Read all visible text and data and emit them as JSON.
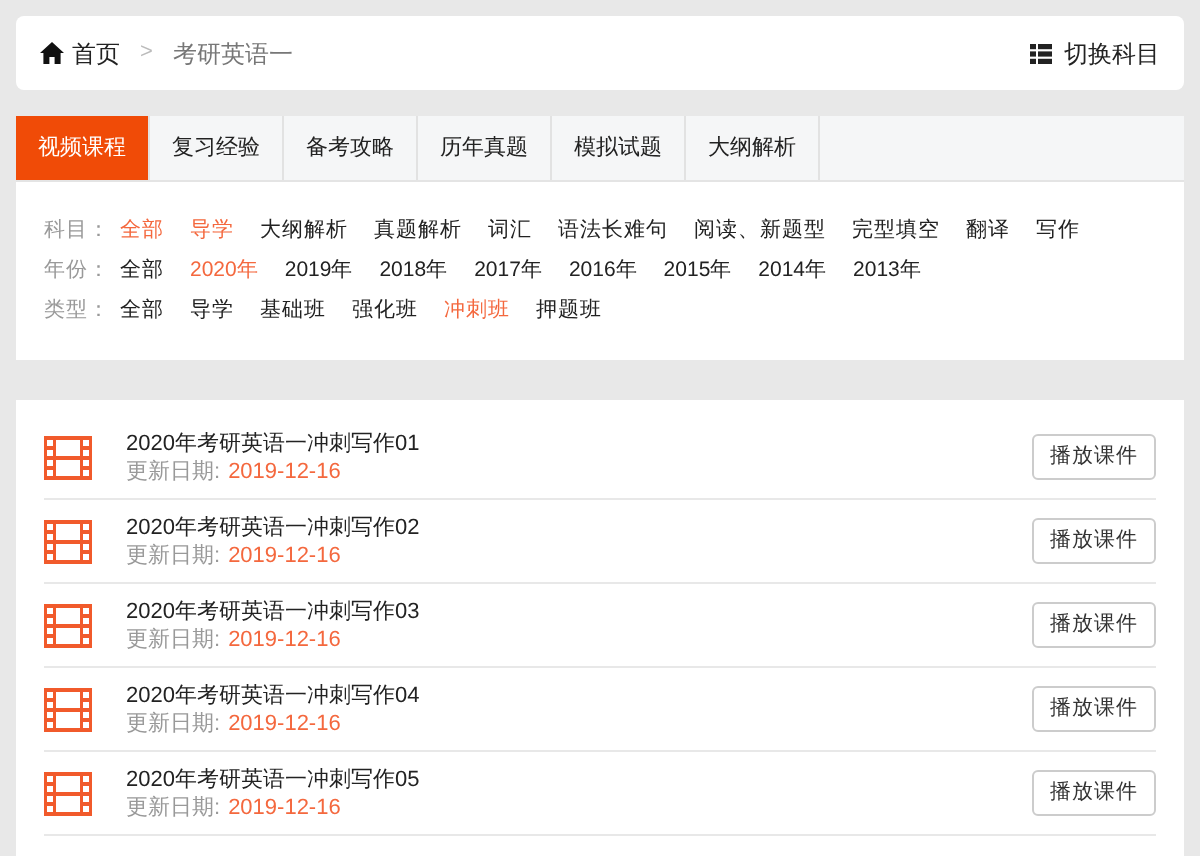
{
  "breadcrumb": {
    "home": "首页",
    "separator": ">",
    "current": "考研英语一"
  },
  "switch_button": "切换科目",
  "tabs": [
    {
      "label": "视频课程",
      "selected": true
    },
    {
      "label": "复习经验",
      "selected": false
    },
    {
      "label": "备考攻略",
      "selected": false
    },
    {
      "label": "历年真题",
      "selected": false
    },
    {
      "label": "模拟试题",
      "selected": false
    },
    {
      "label": "大纲解析",
      "selected": false
    }
  ],
  "filters": [
    {
      "label": "科目：",
      "options": [
        {
          "label": "全部",
          "selected": true
        },
        {
          "label": "导学",
          "selected": true
        },
        {
          "label": "大纲解析",
          "selected": false
        },
        {
          "label": "真题解析",
          "selected": false
        },
        {
          "label": "词汇",
          "selected": false
        },
        {
          "label": "语法长难句",
          "selected": false
        },
        {
          "label": "阅读、新题型",
          "selected": false
        },
        {
          "label": "完型填空",
          "selected": false
        },
        {
          "label": "翻译",
          "selected": false
        },
        {
          "label": "写作",
          "selected": false
        }
      ]
    },
    {
      "label": "年份：",
      "options": [
        {
          "label": "全部",
          "selected": false
        },
        {
          "label": "2020年",
          "selected": true
        },
        {
          "label": "2019年",
          "selected": false
        },
        {
          "label": "2018年",
          "selected": false
        },
        {
          "label": "2017年",
          "selected": false
        },
        {
          "label": "2016年",
          "selected": false
        },
        {
          "label": "2015年",
          "selected": false
        },
        {
          "label": "2014年",
          "selected": false
        },
        {
          "label": "2013年",
          "selected": false
        }
      ]
    },
    {
      "label": "类型：",
      "options": [
        {
          "label": "全部",
          "selected": false
        },
        {
          "label": "导学",
          "selected": false
        },
        {
          "label": "基础班",
          "selected": false
        },
        {
          "label": "强化班",
          "selected": false
        },
        {
          "label": "冲刺班",
          "selected": true
        },
        {
          "label": "押题班",
          "selected": false
        }
      ]
    }
  ],
  "courses": [
    {
      "title": "2020年考研英语一冲刺写作01",
      "date_label": "更新日期:",
      "date": "2019-12-16",
      "button": "播放课件"
    },
    {
      "title": "2020年考研英语一冲刺写作02",
      "date_label": "更新日期:",
      "date": "2019-12-16",
      "button": "播放课件"
    },
    {
      "title": "2020年考研英语一冲刺写作03",
      "date_label": "更新日期:",
      "date": "2019-12-16",
      "button": "播放课件"
    },
    {
      "title": "2020年考研英语一冲刺写作04",
      "date_label": "更新日期:",
      "date": "2019-12-16",
      "button": "播放课件"
    },
    {
      "title": "2020年考研英语一冲刺写作05",
      "date_label": "更新日期:",
      "date": "2019-12-16",
      "button": "播放课件"
    }
  ]
}
